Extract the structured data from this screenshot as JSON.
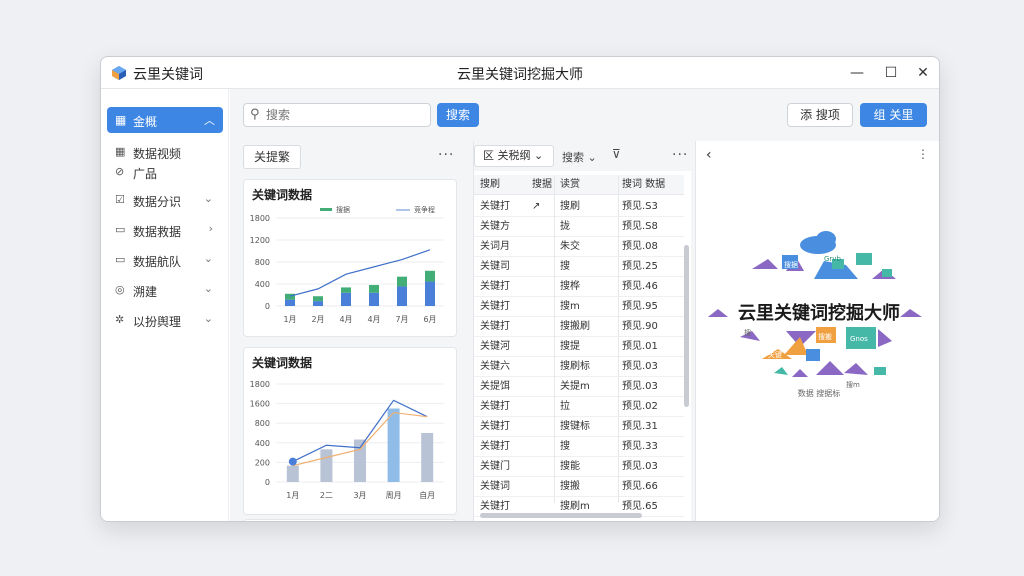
{
  "app": {
    "name": "云里关键词",
    "window_title": "云里关键词挖掘大师",
    "controls": [
      "—",
      "☐",
      "✕"
    ]
  },
  "sidebar": {
    "active": {
      "icon": "grid-icon",
      "label": "金概"
    },
    "items": [
      {
        "icon": "grid-icon",
        "label": "数据视频"
      },
      {
        "icon": "tag-icon",
        "label": "广品"
      },
      {
        "icon": "check-icon",
        "label": "数据分识"
      },
      {
        "icon": "doc-icon",
        "label": "数据救据"
      },
      {
        "icon": "doc-icon",
        "label": "数据航队"
      },
      {
        "icon": "globe-icon",
        "label": "溯建"
      },
      {
        "icon": "gear-icon",
        "label": "以扮舆理"
      }
    ]
  },
  "toolbar": {
    "search_placeholder": "搜索",
    "search_button": "搜索",
    "btn_secondary": "添 搜项",
    "btn_primary": "组 关里"
  },
  "left_panel": {
    "tab": "关提繁",
    "more": "···"
  },
  "charts": [
    {
      "title": "关键词数据",
      "chart_data": {
        "type": "bar",
        "categories": [
          "1月",
          "2月",
          "4月",
          "4月",
          "7月",
          "6月"
        ],
        "series": [
          {
            "name": "搜据",
            "values": [
              130,
              100,
              270,
              270,
              400,
              500
            ]
          },
          {
            "name": "搜据",
            "values": [
              120,
              100,
              110,
              160,
              200,
              220
            ]
          },
          {
            "name": "搜据",
            "values": [
              200,
              350,
              650,
              800,
              950,
              1150
            ]
          }
        ],
        "legend": [
          "搜据",
          "竞争程"
        ],
        "yticks": [
          0,
          400,
          800,
          1200,
          1600,
          1800
        ],
        "ylim": [
          0,
          1800
        ]
      }
    },
    {
      "title": "关键词数据",
      "chart_data": {
        "type": "bar",
        "categories": [
          "1月",
          "2二",
          "3月",
          "周月",
          "自月"
        ],
        "series": [
          {
            "values": [
              200,
              400,
              520,
              900,
              600
            ]
          },
          {
            "values": [
              250,
              450,
              420,
              1000,
              800
            ]
          },
          {
            "values": [
              200,
              300,
              400,
              850,
              800
            ]
          }
        ],
        "yticks": [
          0,
          200,
          400,
          800,
          1600,
          1800
        ],
        "ylim": [
          0,
          1200
        ]
      }
    }
  ],
  "table": {
    "toolbar": {
      "filter": "区 关税纲",
      "sort": "搜索",
      "filter_icon": "⊽",
      "more": "···"
    },
    "headers": [
      "搜刷",
      "搜据",
      "读赏",
      "搜词 数据"
    ],
    "rows": [
      [
        "关键打",
        "↗",
        "搜刷",
        "预见.S3"
      ],
      [
        "关键方",
        "",
        "拢",
        "预见.S8"
      ],
      [
        "关词月",
        "",
        "朱交",
        "预见.08"
      ],
      [
        "关键司",
        "",
        "搜",
        "预见.25"
      ],
      [
        "关键打",
        "",
        "搜桦",
        "预见.46"
      ],
      [
        "关键打",
        "",
        "搜m",
        "预见.95"
      ],
      [
        "关键打",
        "",
        "搜搬刷",
        "预见.90"
      ],
      [
        "关键河",
        "",
        "搜提",
        "预见.01"
      ],
      [
        "关键六",
        "",
        "搜刷标",
        "预见.03"
      ],
      [
        "关提饵",
        "",
        "关提m",
        "预见.03"
      ],
      [
        "关键打",
        "",
        "拉",
        "预见.02"
      ],
      [
        "关键打",
        "",
        "搜键标",
        "预见.31"
      ],
      [
        "关键打",
        "",
        "搜",
        "预见.33"
      ],
      [
        "关键门",
        "",
        "搜能",
        "预见.03"
      ],
      [
        "关键词",
        "",
        "搜搬",
        "预见.66"
      ],
      [
        "关键打",
        "",
        "搜刷m",
        "预见.65"
      ]
    ]
  },
  "cloud": {
    "back": "‹",
    "more": "⋮",
    "title": "云里关键词挖掘大师",
    "subtitle": "数据 搜据标",
    "tags": [
      "Grvb",
      "搜据",
      "搜",
      "Gnos",
      "搜搬",
      "关键",
      "搜m"
    ]
  },
  "colors": {
    "accent": "#3d86e3",
    "bar_blue": "#4a7fd9",
    "bar_green": "#43ad78",
    "bar_light": "#8fbde8",
    "line_orange": "#f0b070",
    "cloud_purple": "#8a68c4",
    "cloud_blue": "#4a8ee0",
    "cloud_teal": "#45b8a8",
    "cloud_orange": "#f0a040"
  }
}
